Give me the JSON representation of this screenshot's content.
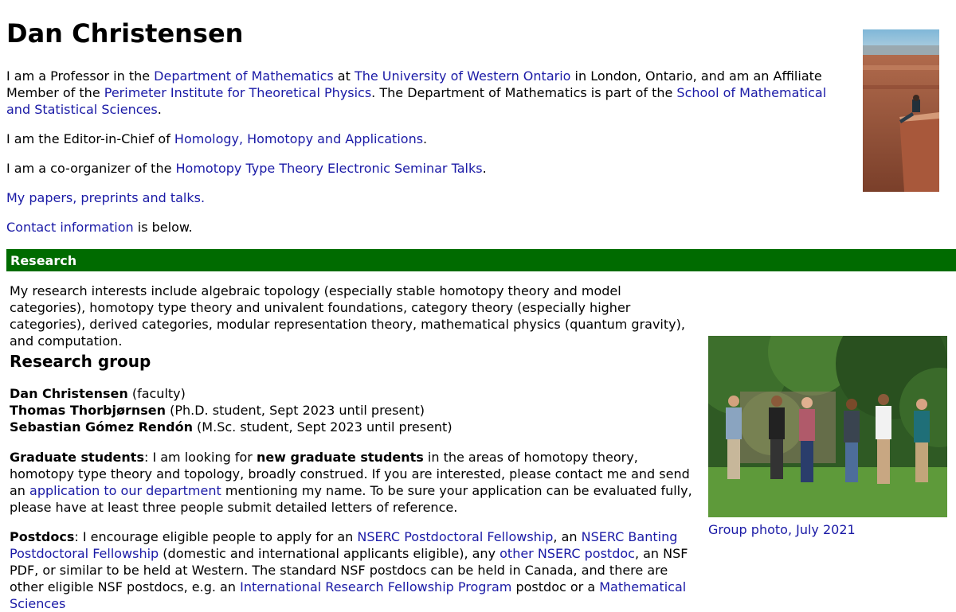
{
  "title": "Dan Christensen",
  "intro": {
    "p1": {
      "t1": "I am a Professor in the ",
      "l1": "Department of Mathematics",
      "t2": " at ",
      "l2": "The University of Western Ontario",
      "t3": " in London, Ontario, and am an Affiliate Member of the ",
      "l3": "Perimeter Institute for Theoretical Physics",
      "t4": ". The Department of Mathematics is part of the ",
      "l4": "School of Mathematical and Statistical Sciences",
      "t5": "."
    },
    "p2": {
      "t1": "I am the Editor-in-Chief of ",
      "l1": "Homology, Homotopy and Applications",
      "t2": "."
    },
    "p3": {
      "t1": "I am a co-organizer of the ",
      "l1": "Homotopy Type Theory Electronic Seminar Talks",
      "t2": "."
    },
    "p4": {
      "l1": "My papers, preprints and talks."
    },
    "p5": {
      "l1": "Contact information",
      "t1": " is below."
    }
  },
  "research": {
    "header": "Research",
    "interests": "My research interests include algebraic topology (especially stable homotopy theory and model categories), homotopy type theory and univalent foundations, category theory (especially higher categories), derived categories, modular representation theory, mathematical physics (quantum gravity), and computation.",
    "group_heading": "Research group",
    "members": [
      {
        "name": "Dan Christensen",
        "role": " (faculty)"
      },
      {
        "name": "Thomas Thorbjørnsen",
        "role": " (Ph.D. student, Sept 2023 until present)"
      },
      {
        "name": "Sebastian Gómez Rendón",
        "role": " (M.Sc. student, Sept 2023 until present)"
      }
    ],
    "grad": {
      "label": "Graduate students",
      "t1": ": I am looking for ",
      "bold": "new graduate students",
      "t2": " in the areas of homotopy theory, homotopy type theory and topology, broadly construed. If you are interested, please contact me and send an ",
      "l1": "application to our department",
      "t3": " mentioning my name. To be sure your application can be evaluated fully, please have at least three people submit detailed letters of reference."
    },
    "postdocs": {
      "label": "Postdocs",
      "t1": ": I encourage eligible people to apply for an ",
      "l1": "NSERC Postdoctoral Fellowship",
      "t2": ", an ",
      "l2": "NSERC Banting Postdoctoral Fellowship",
      "t3": " (domestic and international applicants eligible), any ",
      "l3": "other NSERC postdoc",
      "t4": ", an NSF PDF, or similar to be held at Western. The standard NSF postdocs can be held in Canada, and there are other eligible NSF postdocs, e.g. an ",
      "l4": "International Research Fellowship Program",
      "t5": " postdoc or a ",
      "l5": "Mathematical Sciences"
    },
    "photo_caption": "Group photo, July 2021"
  }
}
